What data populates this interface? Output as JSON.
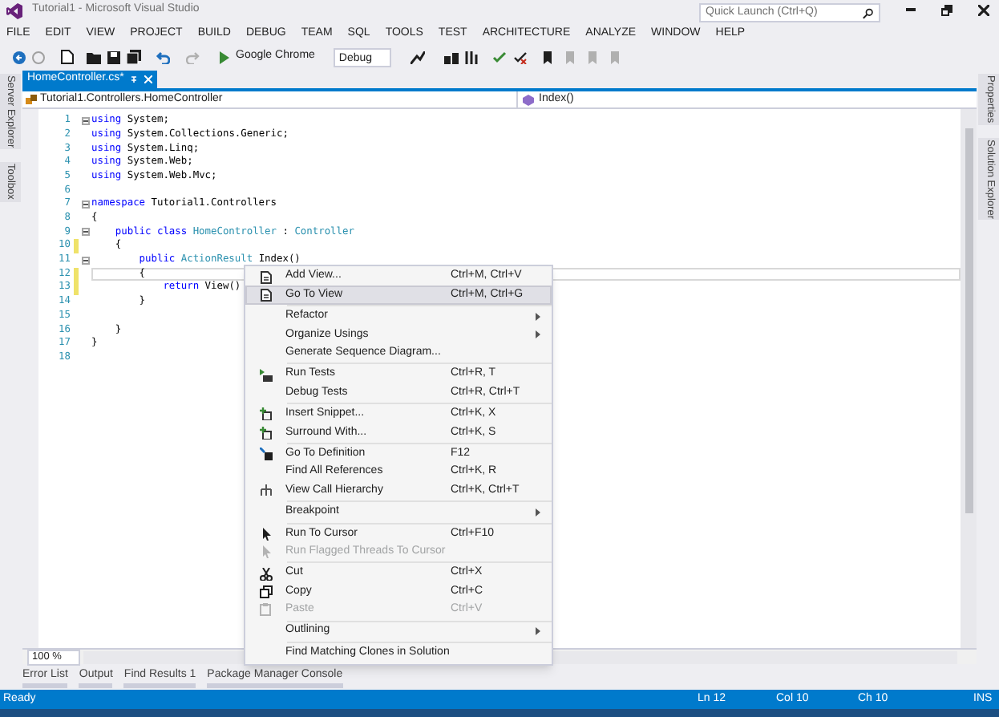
{
  "window": {
    "title": "Tutorial1 - Microsoft Visual Studio"
  },
  "quick_launch": {
    "placeholder": "Quick Launch (Ctrl+Q)"
  },
  "menu": [
    "FILE",
    "EDIT",
    "VIEW",
    "PROJECT",
    "BUILD",
    "DEBUG",
    "TEAM",
    "SQL",
    "TOOLS",
    "TEST",
    "ARCHITECTURE",
    "ANALYZE",
    "WINDOW",
    "HELP"
  ],
  "toolbar": {
    "browser": "Google Chrome",
    "configuration": "Debug"
  },
  "left_panels": [
    "Server Explorer",
    "Toolbox"
  ],
  "right_panels": [
    "Properties",
    "Solution Explorer"
  ],
  "document_tabs": [
    {
      "label": "HomeController.cs*",
      "selected": true
    }
  ],
  "navigation": {
    "type_dropdown": "Tutorial1.Controllers.HomeController",
    "member_dropdown": "Index()"
  },
  "code_lines": [
    {
      "number": "1",
      "fold": true,
      "changed": false,
      "current": false,
      "tokens": [
        {
          "kind": "keyword",
          "text": "using"
        },
        {
          "kind": "plain",
          "text": " System;"
        }
      ]
    },
    {
      "number": "2",
      "fold": false,
      "changed": false,
      "current": false,
      "tokens": [
        {
          "kind": "keyword",
          "text": "using"
        },
        {
          "kind": "plain",
          "text": " System.Collections.Generic;"
        }
      ]
    },
    {
      "number": "3",
      "fold": false,
      "changed": false,
      "current": false,
      "tokens": [
        {
          "kind": "keyword",
          "text": "using"
        },
        {
          "kind": "plain",
          "text": " System.Linq;"
        }
      ]
    },
    {
      "number": "4",
      "fold": false,
      "changed": false,
      "current": false,
      "tokens": [
        {
          "kind": "keyword",
          "text": "using"
        },
        {
          "kind": "plain",
          "text": " System.Web;"
        }
      ]
    },
    {
      "number": "5",
      "fold": false,
      "changed": false,
      "current": false,
      "tokens": [
        {
          "kind": "keyword",
          "text": "using"
        },
        {
          "kind": "plain",
          "text": " System.Web.Mvc;"
        }
      ]
    },
    {
      "number": "6",
      "fold": false,
      "changed": false,
      "current": false
    },
    {
      "number": "7",
      "fold": true,
      "changed": false,
      "current": false,
      "tokens": [
        {
          "kind": "keyword",
          "text": "namespace"
        },
        {
          "kind": "plain",
          "text": " Tutorial1.Controllers"
        }
      ]
    },
    {
      "number": "8",
      "fold": false,
      "changed": false,
      "current": false,
      "tokens": [
        {
          "kind": "plain",
          "text": "{"
        }
      ]
    },
    {
      "number": "9",
      "fold": true,
      "changed": false,
      "current": false,
      "tokens": [
        {
          "kind": "keyword",
          "text": "    public class"
        },
        {
          "kind": "type",
          "text": " HomeController"
        },
        {
          "kind": "plain",
          "text": " : "
        },
        {
          "kind": "type",
          "text": "Controller"
        }
      ]
    },
    {
      "number": "10",
      "fold": false,
      "changed": true,
      "current": false,
      "tokens": [
        {
          "kind": "plain",
          "text": "    {"
        }
      ]
    },
    {
      "number": "11",
      "fold": true,
      "changed": false,
      "current": false,
      "tokens": [
        {
          "kind": "keyword",
          "text": "        public"
        },
        {
          "kind": "type",
          "text": " ActionResult"
        },
        {
          "kind": "plain",
          "text": " Index()"
        }
      ]
    },
    {
      "number": "12",
      "fold": false,
      "changed": true,
      "current": true,
      "tokens": [
        {
          "kind": "plain",
          "text": "        {"
        }
      ]
    },
    {
      "number": "13",
      "fold": false,
      "changed": true,
      "current": false,
      "tokens": [
        {
          "kind": "keyword",
          "text": "            return"
        },
        {
          "kind": "plain",
          "text": " View()"
        }
      ]
    },
    {
      "number": "14",
      "fold": false,
      "changed": false,
      "current": false,
      "tokens": [
        {
          "kind": "plain",
          "text": "        }"
        }
      ]
    },
    {
      "number": "15",
      "fold": false,
      "changed": false,
      "current": false
    },
    {
      "number": "16",
      "fold": false,
      "changed": false,
      "current": false,
      "tokens": [
        {
          "kind": "plain",
          "text": "    }"
        }
      ]
    },
    {
      "number": "17",
      "fold": false,
      "changed": false,
      "current": false,
      "tokens": [
        {
          "kind": "plain",
          "text": "}"
        }
      ]
    },
    {
      "number": "18",
      "fold": false,
      "changed": false,
      "current": false
    }
  ],
  "context_menu": [
    {
      "items": [
        {
          "label": "Add View...",
          "shortcut": "Ctrl+M, Ctrl+V",
          "selected": false,
          "disabled": false,
          "submenu": false
        },
        {
          "label": "Go To View",
          "shortcut": "Ctrl+M, Ctrl+G",
          "selected": true,
          "disabled": false,
          "submenu": false
        }
      ]
    },
    {
      "items": [
        {
          "label": "Refactor",
          "selected": false,
          "disabled": false,
          "submenu": true
        },
        {
          "label": "Organize Usings",
          "selected": false,
          "disabled": false,
          "submenu": true
        },
        {
          "label": "Generate Sequence Diagram...",
          "selected": false,
          "disabled": false,
          "submenu": false
        }
      ]
    },
    {
      "items": [
        {
          "label": "Run Tests",
          "shortcut": "Ctrl+R, T",
          "selected": false,
          "disabled": false,
          "submenu": false
        },
        {
          "label": "Debug Tests",
          "shortcut": "Ctrl+R, Ctrl+T",
          "selected": false,
          "disabled": false,
          "submenu": false
        }
      ]
    },
    {
      "items": [
        {
          "label": "Insert Snippet...",
          "shortcut": "Ctrl+K, X",
          "selected": false,
          "disabled": false,
          "submenu": false
        },
        {
          "label": "Surround With...",
          "shortcut": "Ctrl+K, S",
          "selected": false,
          "disabled": false,
          "submenu": false
        }
      ]
    },
    {
      "items": [
        {
          "label": "Go To Definition",
          "shortcut": "F12",
          "selected": false,
          "disabled": false,
          "submenu": false
        },
        {
          "label": "Find All References",
          "shortcut": "Ctrl+K, R",
          "selected": false,
          "disabled": false,
          "submenu": false
        },
        {
          "label": "View Call Hierarchy",
          "shortcut": "Ctrl+K, Ctrl+T",
          "selected": false,
          "disabled": false,
          "submenu": false
        }
      ]
    },
    {
      "items": [
        {
          "label": "Breakpoint",
          "selected": false,
          "disabled": false,
          "submenu": true
        }
      ]
    },
    {
      "items": [
        {
          "label": "Run To Cursor",
          "shortcut": "Ctrl+F10",
          "selected": false,
          "disabled": false,
          "submenu": false
        },
        {
          "label": "Run Flagged Threads To Cursor",
          "selected": false,
          "disabled": true,
          "submenu": false
        }
      ]
    },
    {
      "items": [
        {
          "label": "Cut",
          "shortcut": "Ctrl+X",
          "selected": false,
          "disabled": false,
          "submenu": false
        },
        {
          "label": "Copy",
          "shortcut": "Ctrl+C",
          "selected": false,
          "disabled": false,
          "submenu": false
        },
        {
          "label": "Paste",
          "shortcut": "Ctrl+V",
          "selected": false,
          "disabled": true,
          "submenu": false
        }
      ]
    },
    {
      "items": [
        {
          "label": "Outlining",
          "selected": false,
          "disabled": false,
          "submenu": true
        }
      ]
    },
    {
      "items": [
        {
          "label": "Find Matching Clones in Solution",
          "selected": false,
          "disabled": false,
          "submenu": false
        }
      ]
    }
  ],
  "zoom": "100 %",
  "tool_tabs": [
    "Error List",
    "Output",
    "Find Results 1",
    "Package Manager Console"
  ],
  "status_bar": {
    "message": "Ready",
    "line": "Ln 12",
    "column": "Col 10",
    "character": "Ch 10",
    "mode": "INS"
  }
}
